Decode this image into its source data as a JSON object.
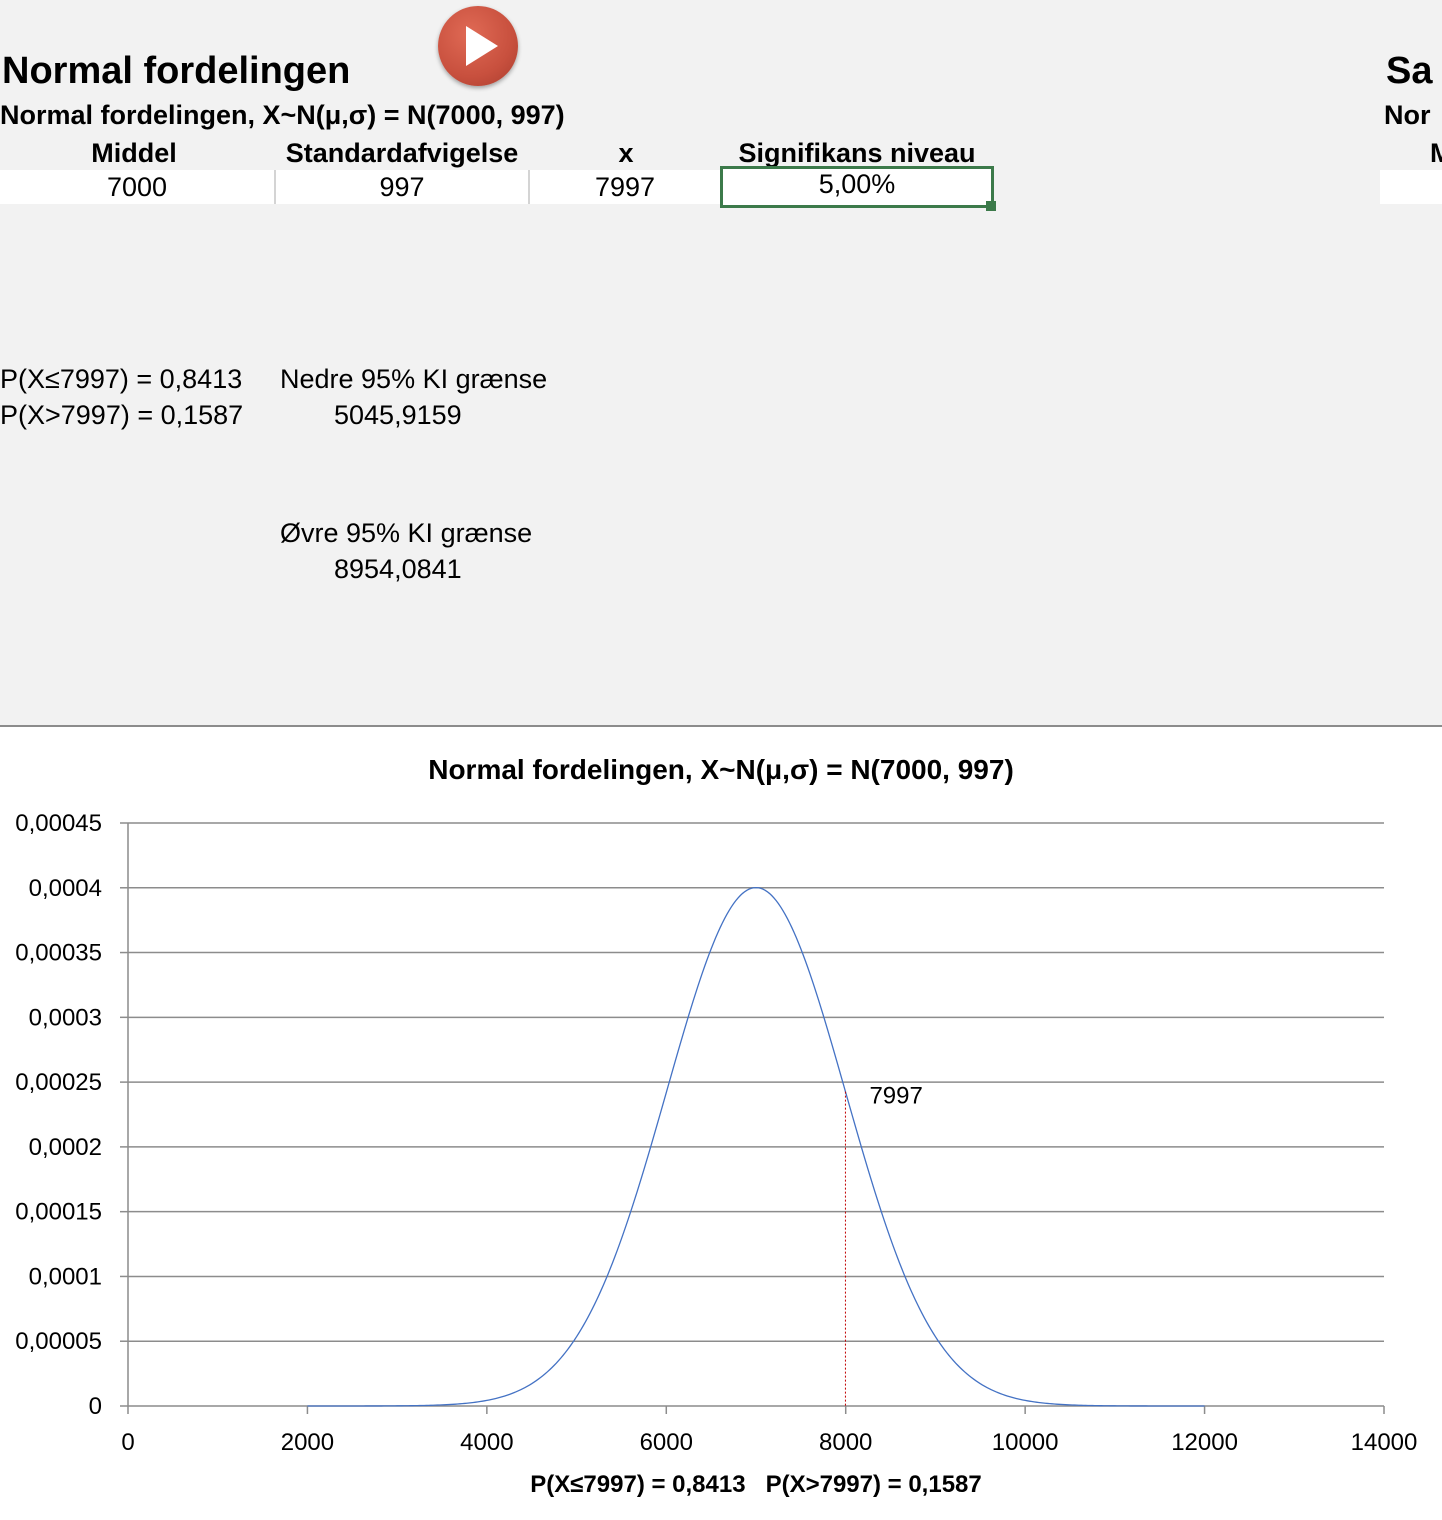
{
  "sheet": {
    "title": "Normal fordelingen",
    "title_right": "Sa",
    "subtitle": "Normal fordelingen, X~N(μ,σ) = N(7000, 997)",
    "subtitle_right": "Nor",
    "col_right": "M",
    "headers": {
      "mean": "Middel",
      "sd": "Standardafvigelse",
      "x": "x",
      "significance": "Signifikans niveau"
    },
    "values": {
      "mean": "7000",
      "sd": "997",
      "x": "7997",
      "significance": "5,00%"
    },
    "prob_le": "P(X≤7997) = 0,8413",
    "prob_gt": "P(X>7997) = 0,1587",
    "lower_ci_label": "Nedre 95% KI grænse",
    "lower_ci_value": "5045,9159",
    "upper_ci_label": "Øvre 95% KI grænse",
    "upper_ci_value": "8954,0841",
    "play_icon": "play-icon",
    "accent_colors": {
      "selection": "#3c7a4a",
      "play_button": "#c8503e"
    }
  },
  "chart_data": {
    "type": "line",
    "title": "Normal fordelingen, X~N(μ,σ) = N(7000, 997)",
    "xlabel": "P(X≤7997) = 0,8413   P(X>7997) = 0,1587",
    "ylabel": "",
    "series": [
      {
        "type": "normal_pdf",
        "mean": 7000,
        "sd": 997,
        "x_range": [
          2000,
          12000
        ],
        "color": "#4472c4"
      }
    ],
    "marker": {
      "x": 7997,
      "label": "7997",
      "color": "#c00000"
    },
    "xlim": [
      0,
      14000
    ],
    "ylim": [
      0,
      0.00045
    ],
    "x_ticks": [
      0,
      2000,
      4000,
      6000,
      8000,
      10000,
      12000,
      14000
    ],
    "x_tick_labels": [
      "0",
      "2000",
      "4000",
      "6000",
      "8000",
      "10000",
      "12000",
      "14000"
    ],
    "y_ticks": [
      0,
      5e-05,
      0.0001,
      0.00015,
      0.0002,
      0.00025,
      0.0003,
      0.00035,
      0.0004,
      0.00045
    ],
    "y_tick_labels": [
      "0",
      "0,00005",
      "0,0001",
      "0,00015",
      "0,0002",
      "0,00025",
      "0,0003",
      "0,00035",
      "0,0004",
      "0,00045"
    ],
    "grid": true,
    "legend": "none"
  }
}
